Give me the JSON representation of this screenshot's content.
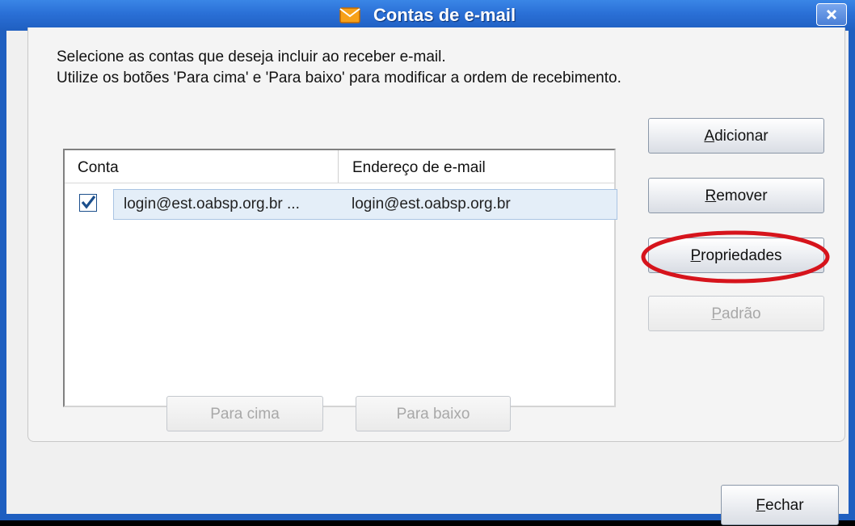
{
  "window": {
    "title": "Contas de e-mail"
  },
  "intro": {
    "line1": "Selecione as contas que deseja incluir ao receber e-mail.",
    "line2": "Utilize os botões 'Para cima' e 'Para baixo' para modificar a ordem de recebimento."
  },
  "list": {
    "headers": {
      "account": "Conta",
      "email": "Endereço de e-mail"
    },
    "rows": [
      {
        "checked": true,
        "account": "login@est.oabsp.org.br ...",
        "email": "login@est.oabsp.org.br"
      }
    ]
  },
  "buttons": {
    "add": {
      "mnemonic": "A",
      "rest": "dicionar"
    },
    "remove": {
      "mnemonic": "R",
      "rest": "emover"
    },
    "properties": {
      "mnemonic": "P",
      "rest": "ropriedades"
    },
    "default": {
      "mnemonic": "P",
      "rest": "adrão"
    },
    "up": "Para cima",
    "down": "Para baixo",
    "close": {
      "mnemonic": "F",
      "rest": "echar"
    }
  },
  "colors": {
    "highlight_ellipse": "#d6141c",
    "titlebar": "#2a6fd6"
  }
}
